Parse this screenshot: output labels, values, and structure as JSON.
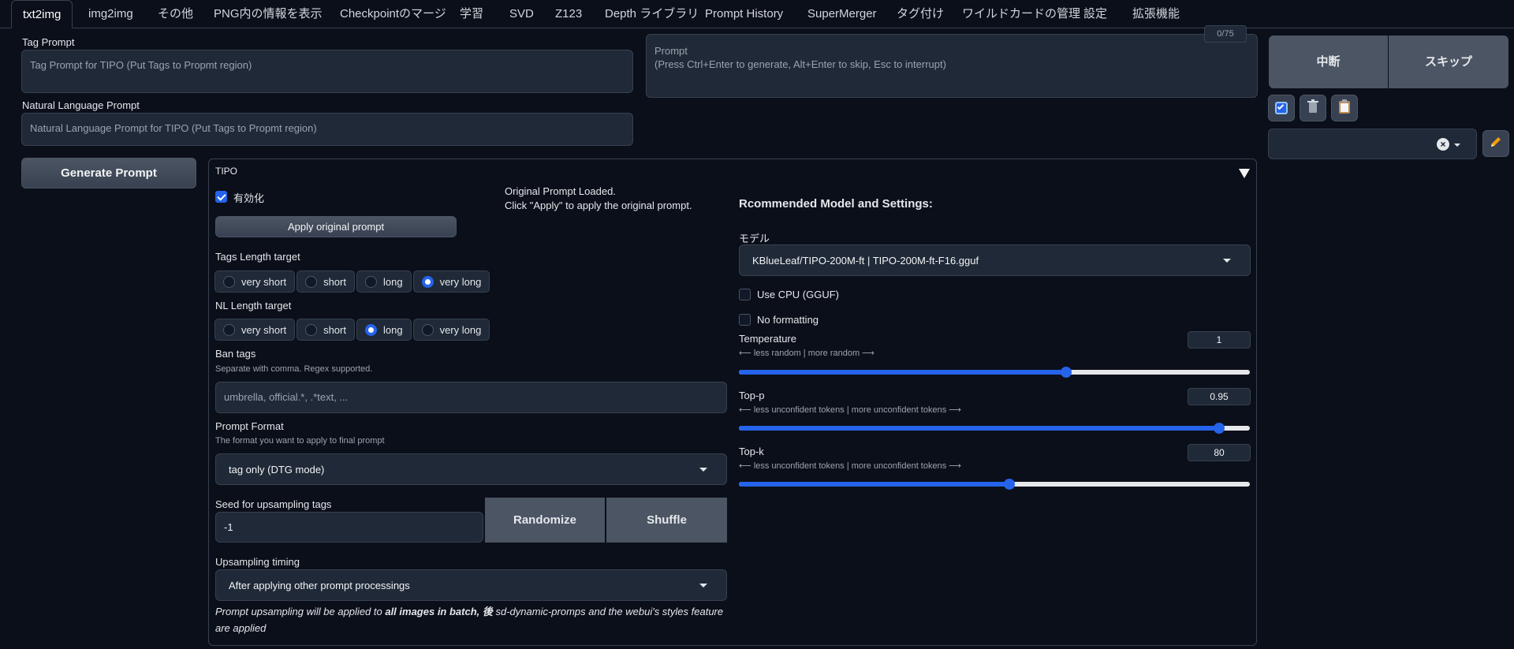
{
  "tabs": [
    "txt2img",
    "img2img",
    "その他",
    "PNG内の情報を表示",
    "Checkpointのマージ",
    "学習",
    "SVD",
    "Z123",
    "Depth ライブラリ",
    "Prompt History",
    "SuperMerger",
    "タグ付け",
    "ワイルドカードの管理",
    "設定",
    "拡張機能"
  ],
  "left": {
    "tag_prompt_label": "Tag Prompt",
    "tag_prompt_placeholder": "Tag Prompt for TIPO (Put Tags to Propmt region)",
    "nl_prompt_label": "Natural Language Prompt",
    "nl_prompt_placeholder": "Natural Language Prompt for TIPO (Put Tags to Propmt region)",
    "generate_button": "Generate Prompt"
  },
  "prompt": {
    "placeholder_line1": "Prompt",
    "placeholder_line2": "(Press Ctrl+Enter to generate, Alt+Enter to skip, Esc to interrupt)",
    "counter": "0/75"
  },
  "actions": {
    "interrupt": "中断",
    "skip": "スキップ"
  },
  "tipo": {
    "title": "TIPO",
    "enable_label": "有効化",
    "enabled": true,
    "apply_button": "Apply original prompt",
    "loaded_line1": "Original Prompt Loaded.",
    "loaded_line2": "Click \"Apply\" to apply the original prompt.",
    "tags_length_label": "Tags Length target",
    "tags_length_options": [
      "very short",
      "short",
      "long",
      "very long"
    ],
    "tags_length_selected": "very long",
    "nl_length_label": "NL Length target",
    "nl_length_options": [
      "very short",
      "short",
      "long",
      "very long"
    ],
    "nl_length_selected": "long",
    "ban_tags_label": "Ban tags",
    "ban_tags_desc": "Separate with comma. Regex supported.",
    "ban_tags_placeholder": "umbrella, official.*, .*text, ...",
    "prompt_format_label": "Prompt Format",
    "prompt_format_desc": "The format you want to apply to final prompt",
    "prompt_format_value": "tag only (DTG mode)",
    "seed_label": "Seed for upsampling tags",
    "seed_value": "-1",
    "randomize_button": "Randomize",
    "shuffle_button": "Shuffle",
    "timing_label": "Upsampling timing",
    "timing_value": "After applying other prompt processings",
    "note_part1": "Prompt upsampling will be applied to ",
    "note_bold": "all images in batch, 後",
    "note_part2": " sd-dynamic-promps and the webui's styles feature are applied",
    "recommended_title": "Rcommended Model and Settings:",
    "model_label": "モデル",
    "model_value": "KBlueLeaf/TIPO-200M-ft | TIPO-200M-ft-F16.gguf",
    "use_cpu_label": "Use CPU (GGUF)",
    "no_formatting_label": "No formatting",
    "temperature_label": "Temperature",
    "temperature_desc": "⟵ less random | more random ⟶",
    "temperature_value": "1",
    "temperature_fraction": 0.64,
    "top_p_label": "Top-p",
    "top_p_desc": "⟵ less unconfident tokens | more unconfident tokens ⟶",
    "top_p_value": "0.95",
    "top_p_fraction": 0.94,
    "top_k_label": "Top-k",
    "top_k_desc": "⟵ less unconfident tokens | more unconfident tokens ⟶",
    "top_k_value": "80",
    "top_k_fraction": 0.53
  },
  "colors": {
    "accent": "#2563eb",
    "background": "#0b0f19",
    "field": "#1f2937"
  }
}
